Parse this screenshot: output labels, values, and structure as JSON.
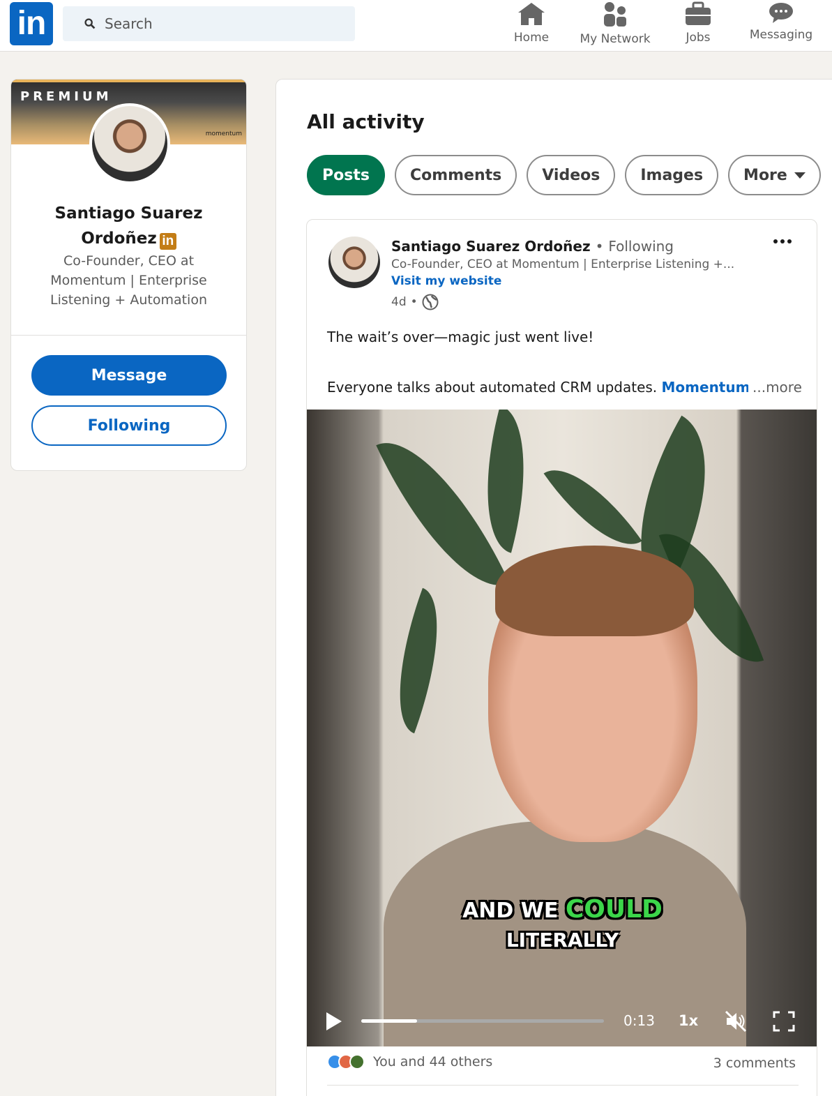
{
  "nav": {
    "logo": "in",
    "search_placeholder": "Search",
    "items": [
      {
        "label": "Home",
        "icon": "home-icon"
      },
      {
        "label": "My Network",
        "icon": "people-icon"
      },
      {
        "label": "Jobs",
        "icon": "briefcase-icon"
      },
      {
        "label": "Messaging",
        "icon": "chat-icon"
      }
    ]
  },
  "profile": {
    "banner_label": "PREMIUM",
    "brand_tag": "momentum",
    "name": "Santiago Suarez Ordoñez",
    "badge": "in",
    "headline": "Co-Founder, CEO at Momentum | Enterprise Listening + Automation",
    "message_label": "Message",
    "following_label": "Following"
  },
  "activity": {
    "title": "All activity",
    "tabs": [
      "Posts",
      "Comments",
      "Videos",
      "Images",
      "More"
    ],
    "active_tab": "Posts"
  },
  "post": {
    "author": "Santiago Suarez Ordoñez",
    "separator": "•",
    "follow_status": "Following",
    "subtitle": "Co-Founder, CEO at Momentum | Enterprise Listening +...",
    "website_label": "Visit my website",
    "age": "4d",
    "visibility_icon": "globe-icon",
    "text_line1": "The wait’s over—magic just went live!",
    "text_line2": "Everyone talks about automated CRM updates.",
    "text_brand": "Momentum",
    "more_label": "...more",
    "reactions_text": "You and 44 others",
    "comments_text": "3 comments",
    "colors": {
      "brand": "#0a66c2",
      "active_tab": "#01754f",
      "caption_highlight": "#3cd64a"
    }
  },
  "video": {
    "caption_words": [
      "AND",
      "WE",
      "COULD"
    ],
    "caption_line2": "LITERALLY",
    "time": "0:13",
    "speed": "1x",
    "progress": 0.23
  }
}
